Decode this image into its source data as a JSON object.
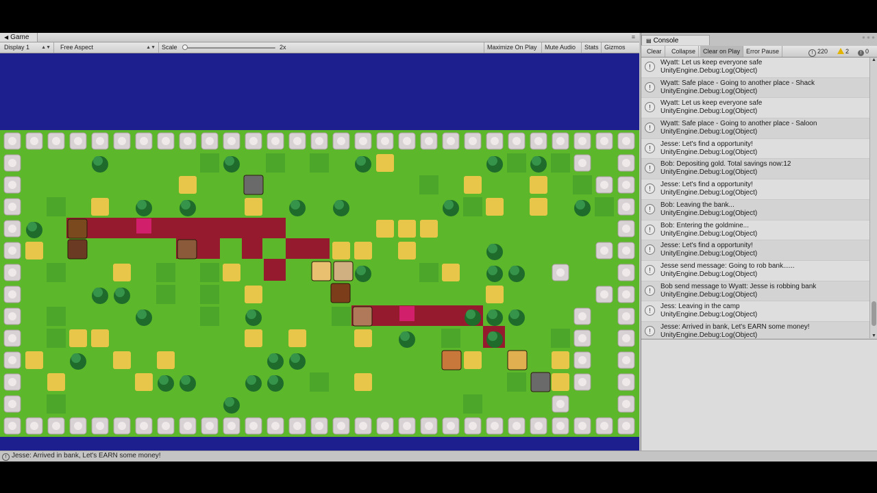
{
  "game_tab": {
    "title": "Game"
  },
  "game_toolbar": {
    "display": "Display 1",
    "aspect": "Free Aspect",
    "scale_label": "Scale",
    "scale_value": "2x",
    "scale_level": 0.02,
    "maximize": "Maximize On Play",
    "mute": "Mute Audio",
    "stats": "Stats",
    "gizmos": "Gizmos"
  },
  "console_tab": {
    "title": "Console"
  },
  "console_toolbar": {
    "clear": "Clear",
    "collapse": "Collapse",
    "clear_on_play": "Clear on Play",
    "error_pause": "Error Pause",
    "log_count": "220",
    "warning_count": "2",
    "error_count": "0"
  },
  "console_logs": [
    {
      "message": "Wyatt: Let us keep everyone safe",
      "source": "UnityEngine.Debug:Log(Object)"
    },
    {
      "message": "Wyatt: Safe place - Going to another place - Shack",
      "source": "UnityEngine.Debug:Log(Object)"
    },
    {
      "message": "Wyatt: Let us keep everyone safe",
      "source": "UnityEngine.Debug:Log(Object)"
    },
    {
      "message": "Wyatt: Safe place - Going to another place - Saloon",
      "source": "UnityEngine.Debug:Log(Object)"
    },
    {
      "message": "Jesse: Let's find a opportunity!",
      "source": "UnityEngine.Debug:Log(Object)"
    },
    {
      "message": "Bob: Depositing gold. Total savings now:12",
      "source": "UnityEngine.Debug:Log(Object)"
    },
    {
      "message": "Jesse: Let's find a opportunity!",
      "source": "UnityEngine.Debug:Log(Object)"
    },
    {
      "message": "Bob: Leaving the bank...",
      "source": "UnityEngine.Debug:Log(Object)"
    },
    {
      "message": "Bob: Entering the goldmine...",
      "source": "UnityEngine.Debug:Log(Object)"
    },
    {
      "message": "Jesse: Let's find a opportunity!",
      "source": "UnityEngine.Debug:Log(Object)"
    },
    {
      "message": "Jesse send message: Going to rob bank......",
      "source": "UnityEngine.Debug:Log(Object)"
    },
    {
      "message": "Bob send message to Wyatt: Jesse is robbing bank",
      "source": "UnityEngine.Debug:Log(Object)"
    },
    {
      "message": "Jess: Leaving in the camp",
      "source": "UnityEngine.Debug:Log(Object)"
    },
    {
      "message": "Jesse: Arrived in bank, Let's EARN some money!",
      "source": "UnityEngine.Debug:Log(Object)"
    }
  ],
  "status_bar": {
    "message": "Jesse: Arrived in bank, Let's EARN some money!"
  },
  "map": {
    "rows": [
      "RRRRRRRRRRRRRRRRRRRRRRRRRRRRR",
      "R...T....dT.d.d.TH....TdTdR",
      "R.......H..d.......d.H..H.dR",
      "R.d.H.T.T..H.T.T....TdH.H.TdR",
      "RT.H.............HHH........T.HR",
      "RH.............HH.H...T....R",
      "R.d..H.d.dH.....T..dH.TT.R",
      "R...TT.d.d.H..........H....R",
      "R.d...T..d.T...d.....TTT..R",
      "R.dHH......H.H..H.T.d.T..dR",
      "RH.T.H.H....TT.......H.H.HR",
      "R.H...HTT..TT.d.H......d.HR",
      "R.d.......T..........d...R",
      "RRRRRRRRRRRRRRRRRRRRRRRRRRRRR"
    ],
    "colors": {
      "grass": "#5cb82a",
      "dark_grass": "#3f9a2a",
      "hay": "#e8c64a",
      "red_zone": "#9b0c2e",
      "water": "#1e1f8e"
    }
  }
}
